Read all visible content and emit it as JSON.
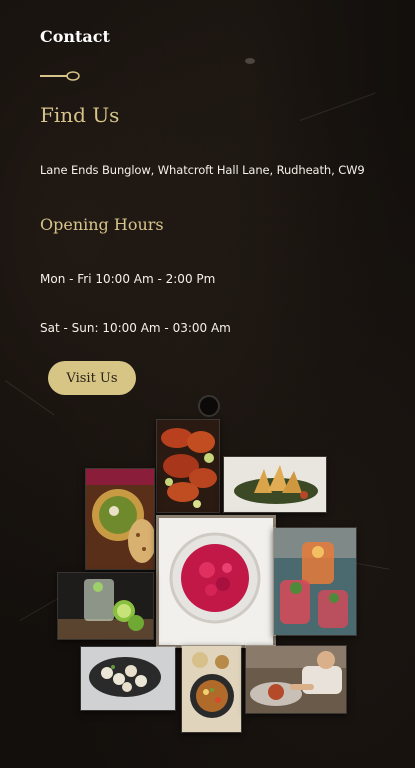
{
  "contact": {
    "label": "Contact"
  },
  "find_us": {
    "title": "Find Us",
    "address": "Lane Ends Bunglow, Whatcroft Hall Lane, Rudheath, CW9"
  },
  "opening_hours": {
    "title": "Opening Hours",
    "weekdays": "Mon - Fri 10:00 Am - 2:00 Pm",
    "weekend": "Sat - Sun: 10:00 Am - 03:00 Am"
  },
  "cta": {
    "visit_label": "Visit Us"
  },
  "gallery": {
    "images": [
      "grilled-chicken-photo",
      "samosa-photo",
      "green-curry-naan-photo",
      "rose-petal-bowl-photo",
      "mocktail-drinks-photo",
      "lime-cocktail-photo",
      "dumpling-platter-photo",
      "spiced-skillet-photo",
      "chef-plating-photo"
    ]
  },
  "colors": {
    "background": "#130f0c",
    "accent_gold": "#d7c48a",
    "button": "#d6c585",
    "text": "#f5f1e8"
  }
}
